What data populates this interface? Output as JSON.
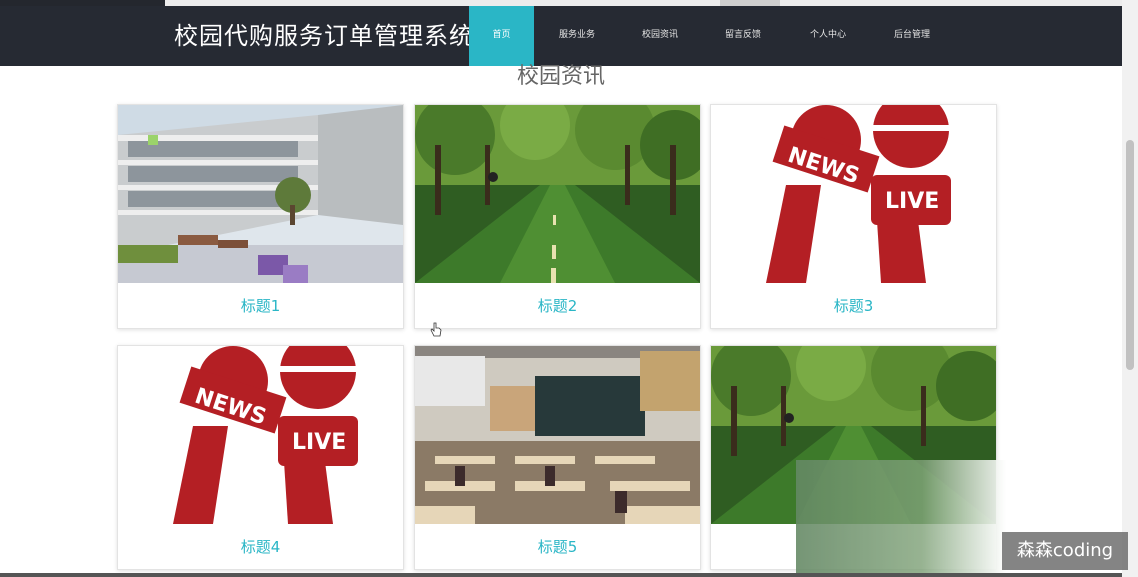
{
  "header": {
    "brand": "校园代购服务订单管理系统",
    "nav": [
      "首页",
      "服务业务",
      "校园资讯",
      "留言反馈",
      "个人中心",
      "后台管理"
    ],
    "active_index": 0
  },
  "section": {
    "title": "校园资讯"
  },
  "cards": [
    {
      "title": "标题1",
      "image": "school-building-image"
    },
    {
      "title": "标题2",
      "image": "tree-lined-road-image"
    },
    {
      "title": "标题3",
      "image": "news-live-microphone-image"
    },
    {
      "title": "标题4",
      "image": "news-live-microphone-image"
    },
    {
      "title": "标题5",
      "image": "classroom-image"
    },
    {
      "title": "",
      "image": "tree-lined-road-image"
    }
  ],
  "watermark": "森森coding",
  "colors": {
    "accent": "#2ab6c6",
    "navbar": "#262a33",
    "news_red": "#b41f24"
  }
}
